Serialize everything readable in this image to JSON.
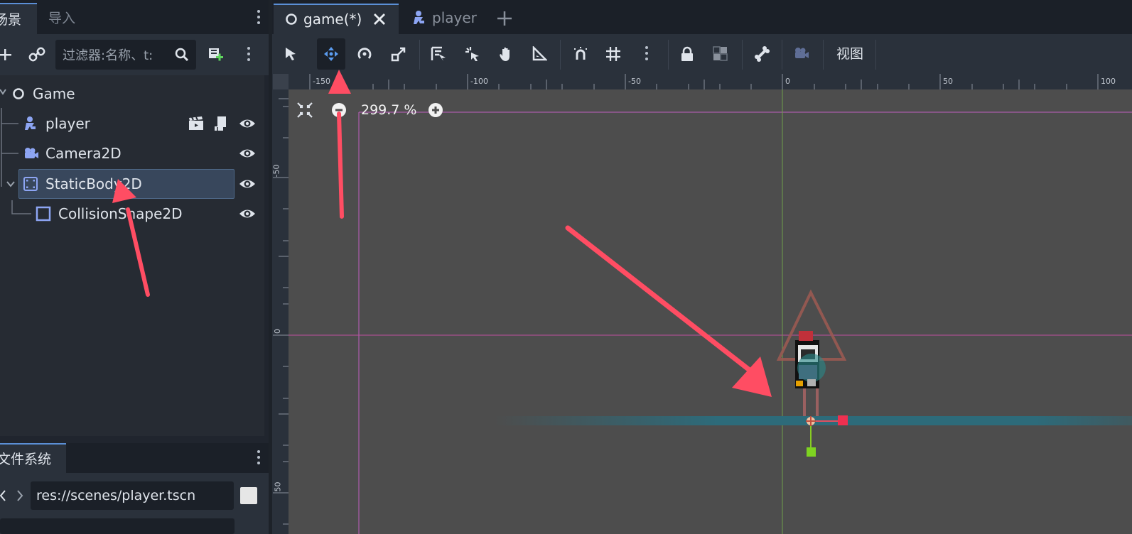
{
  "left_dock": {
    "tabs": {
      "scene": "场景",
      "import": "导入"
    },
    "filter_placeholder": "过滤器:名称、t:",
    "tree": [
      {
        "label": "Game",
        "icon": "node2d-circle-icon"
      },
      {
        "label": "player",
        "icon": "characterbody-icon"
      },
      {
        "label": "Camera2D",
        "icon": "camera-icon"
      },
      {
        "label": "StaticBody2D",
        "icon": "staticbody-icon",
        "selected": true
      },
      {
        "label": "CollisionShape2D",
        "icon": "collisionshape-icon"
      }
    ],
    "filesystem": {
      "tab": "文件系统",
      "path": "res://scenes/player.tscn"
    }
  },
  "editor": {
    "tabs": [
      {
        "label": "game(*)",
        "active": true
      },
      {
        "label": "player",
        "active": false
      }
    ],
    "view_menu": "视图",
    "zoom": "299.7 %",
    "ruler_h": [
      "-150",
      "-100",
      "-50",
      "0",
      "50",
      "100"
    ],
    "ruler_v": [
      "-50",
      "0",
      "50"
    ]
  },
  "colors": {
    "accent": "#5b8fd6",
    "annotation_arrow": "#ff4d63",
    "viewport_bg": "#4d4d4d",
    "floor_band": "#2d6b7a"
  }
}
